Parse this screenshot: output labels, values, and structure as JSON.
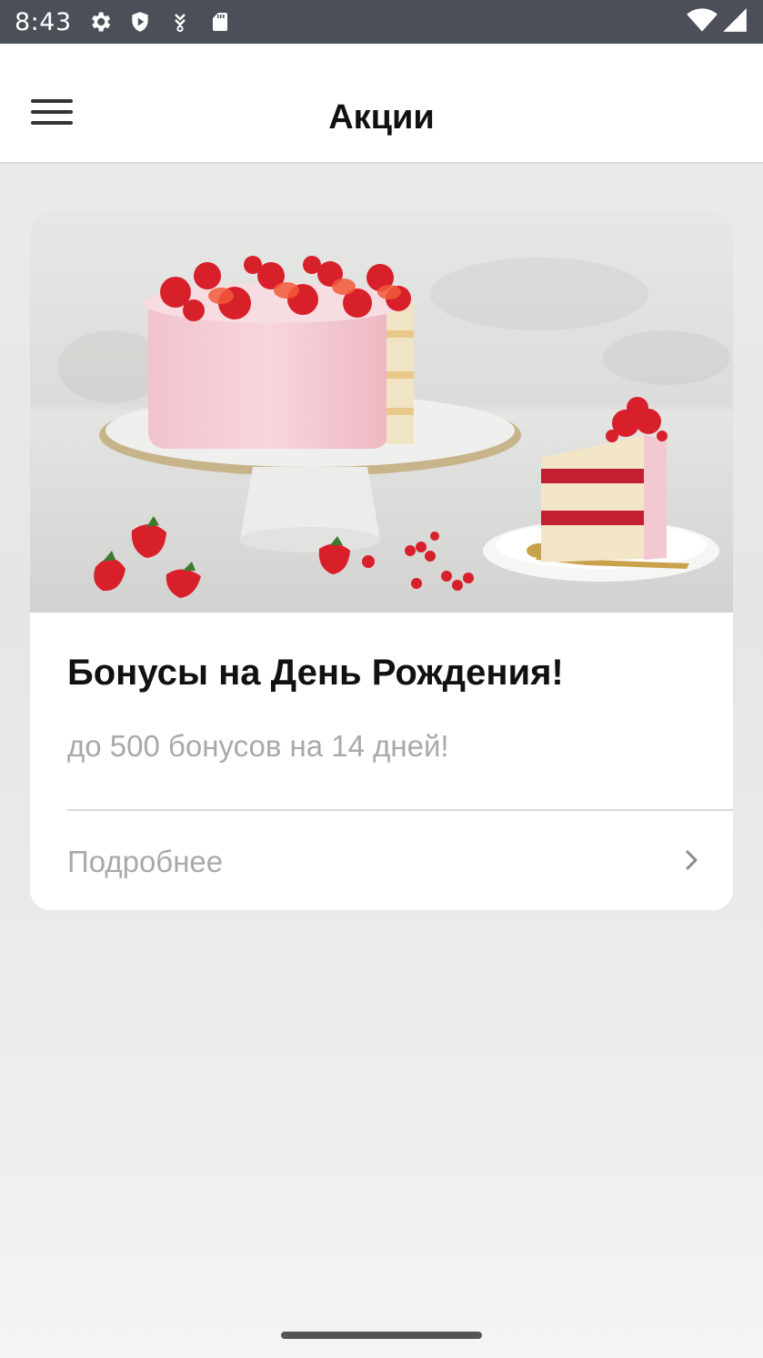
{
  "status_bar": {
    "time": "8:43",
    "icons": [
      "settings-icon",
      "shield-icon",
      "download-icon",
      "sd-card-icon",
      "wifi-icon",
      "signal-icon"
    ],
    "background": "#4b4f57"
  },
  "app_bar": {
    "title": "Акции",
    "menu_icon": "hamburger-menu-icon"
  },
  "promotions": [
    {
      "image": "birthday-cake-photo",
      "title": "Бонусы на День Рождения!",
      "subtitle": "до 500 бонусов на 14 дней!",
      "more_label": "Подробнее",
      "more_icon": "chevron-right-icon"
    }
  ]
}
